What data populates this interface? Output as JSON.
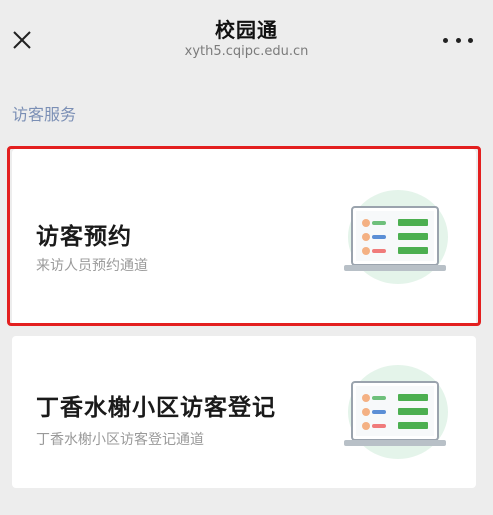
{
  "header": {
    "title": "校园通",
    "url": "xyth5.cqipc.edu.cn"
  },
  "section": {
    "label": "访客服务"
  },
  "cards": [
    {
      "title": "访客预约",
      "subtitle": "来访人员预约通道",
      "selected": true
    },
    {
      "title": "丁香水榭小区访客登记",
      "subtitle": "丁香水榭小区访客登记通道",
      "selected": false
    }
  ],
  "icons": {
    "close": "close-icon",
    "more": "more-icon",
    "illustration": "laptop-visitor-list-illustration"
  },
  "colors": {
    "highlight": "#e31f1f",
    "accent_green": "#4caf50",
    "section_label": "#7b8fb5"
  }
}
